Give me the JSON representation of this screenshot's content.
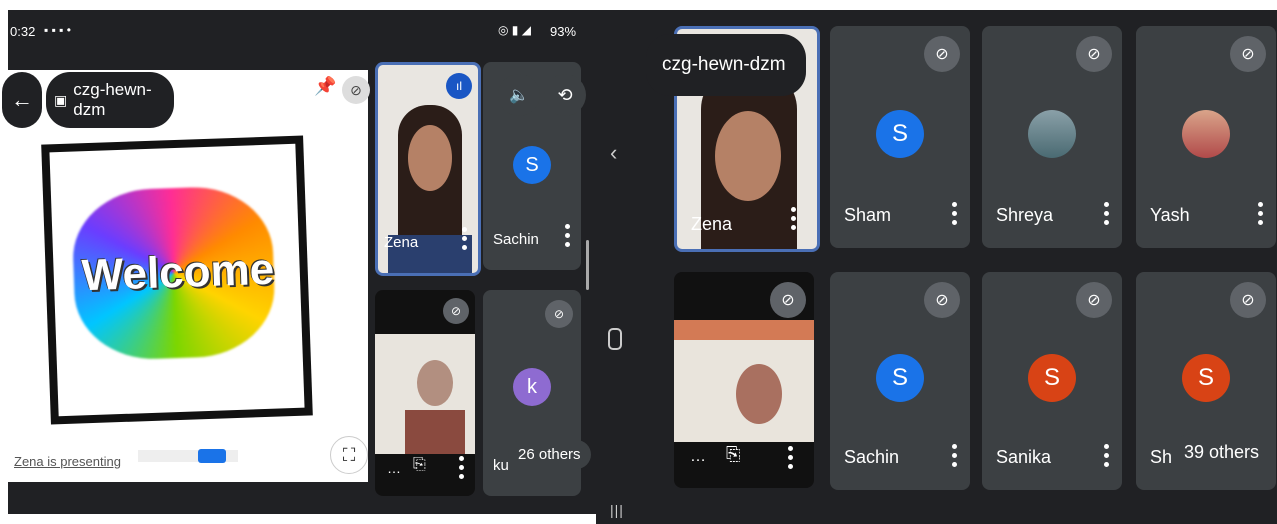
{
  "status_bar": {
    "time": "0:32",
    "battery": "93%"
  },
  "meeting": {
    "code": "czg-hewn-dzm"
  },
  "presentation": {
    "slide_text": "Welcome",
    "presenting_label": "Zena is presenting"
  },
  "left_participants": [
    {
      "name": "Zena"
    },
    {
      "name": "Sachin",
      "initial": "S"
    },
    {
      "name": ""
    },
    {
      "name": "ku",
      "initial": "k"
    }
  ],
  "left_others": "26 others",
  "right_participants": [
    {
      "name": "Zena"
    },
    {
      "name": "Sham",
      "initial": "S"
    },
    {
      "name": "Shreya"
    },
    {
      "name": "Yash"
    },
    {
      "name": ""
    },
    {
      "name": "Sachin",
      "initial": "S"
    },
    {
      "name": "Sanika",
      "initial": "S"
    },
    {
      "name": "Sh",
      "initial": "S"
    }
  ],
  "right_others": "39 others",
  "colors": {
    "bg": "#202124",
    "tile": "#3c4043",
    "blue_avatar": "#1a73e8",
    "orange_avatar": "#d84315",
    "purple_avatar": "#8e6bd1",
    "active_border": "#4a6fb5"
  },
  "icons": [
    "back-arrow-icon",
    "calendar-icon",
    "pin-icon",
    "mic-off-icon",
    "speaker-icon",
    "camera-flip-icon",
    "fullscreen-icon",
    "audio-wave-icon",
    "nav-back-icon",
    "nav-home-icon",
    "nav-recents-icon"
  ]
}
